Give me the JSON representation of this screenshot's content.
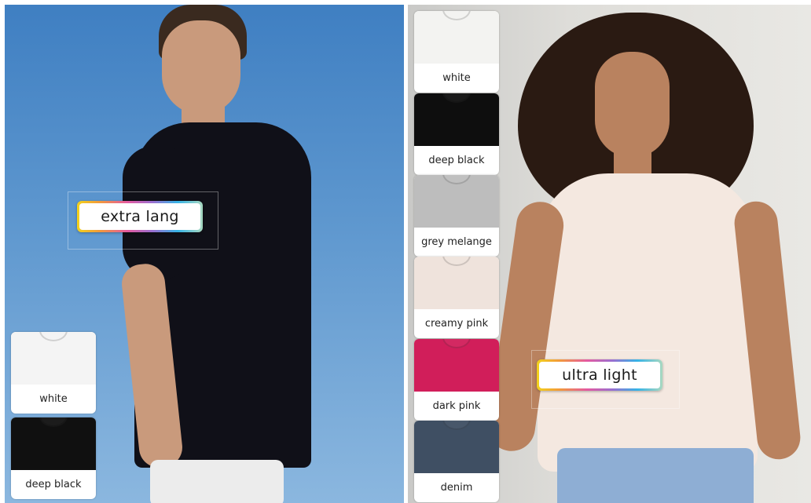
{
  "left_panel": {
    "badge_text": "extra lang",
    "swatches": [
      {
        "label": "white",
        "color": "#f4f4f4"
      },
      {
        "label": "deep black",
        "color": "#101010"
      }
    ]
  },
  "right_panel": {
    "badge_text": "ultra light",
    "swatches": [
      {
        "label": "white",
        "color": "#f3f3f1"
      },
      {
        "label": "deep black",
        "color": "#0e0e0e"
      },
      {
        "label": "grey melange",
        "color": "#bdbdbd"
      },
      {
        "label": "creamy pink",
        "color": "#efe3dc"
      },
      {
        "label": "dark pink",
        "color": "#d11e5a"
      },
      {
        "label": "denim",
        "color": "#3f4f63"
      }
    ]
  }
}
